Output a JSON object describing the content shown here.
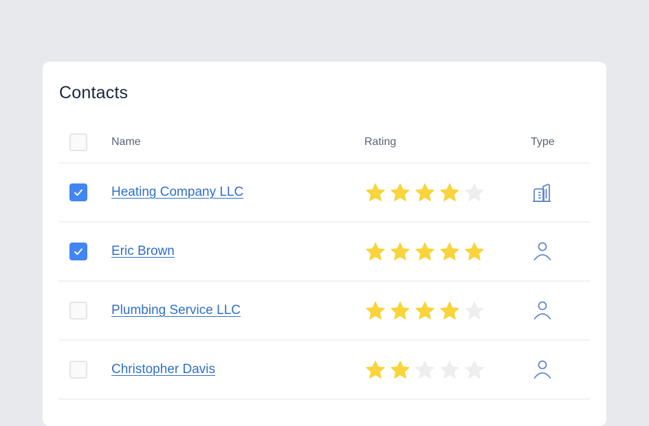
{
  "title": "Contacts",
  "colors": {
    "accent": "#4285f4",
    "link": "#2f6fc9",
    "star_filled": "#f9d43a",
    "star_empty": "#eeeeee",
    "icon": "#5f86c9"
  },
  "table": {
    "columns": [
      "Name",
      "Rating",
      "Type"
    ],
    "select_all_checked": false,
    "max_rating": 5,
    "rows": [
      {
        "name": "Heating Company LLC",
        "checked": true,
        "rating": 4,
        "type": "company",
        "type_icon": "building-icon"
      },
      {
        "name": "Eric Brown",
        "checked": true,
        "rating": 5,
        "type": "person",
        "type_icon": "person-icon"
      },
      {
        "name": "Plumbing Service LLC",
        "checked": false,
        "rating": 4,
        "type": "person",
        "type_icon": "person-icon"
      },
      {
        "name": "Christopher Davis",
        "checked": false,
        "rating": 2,
        "type": "person",
        "type_icon": "person-icon"
      }
    ]
  }
}
